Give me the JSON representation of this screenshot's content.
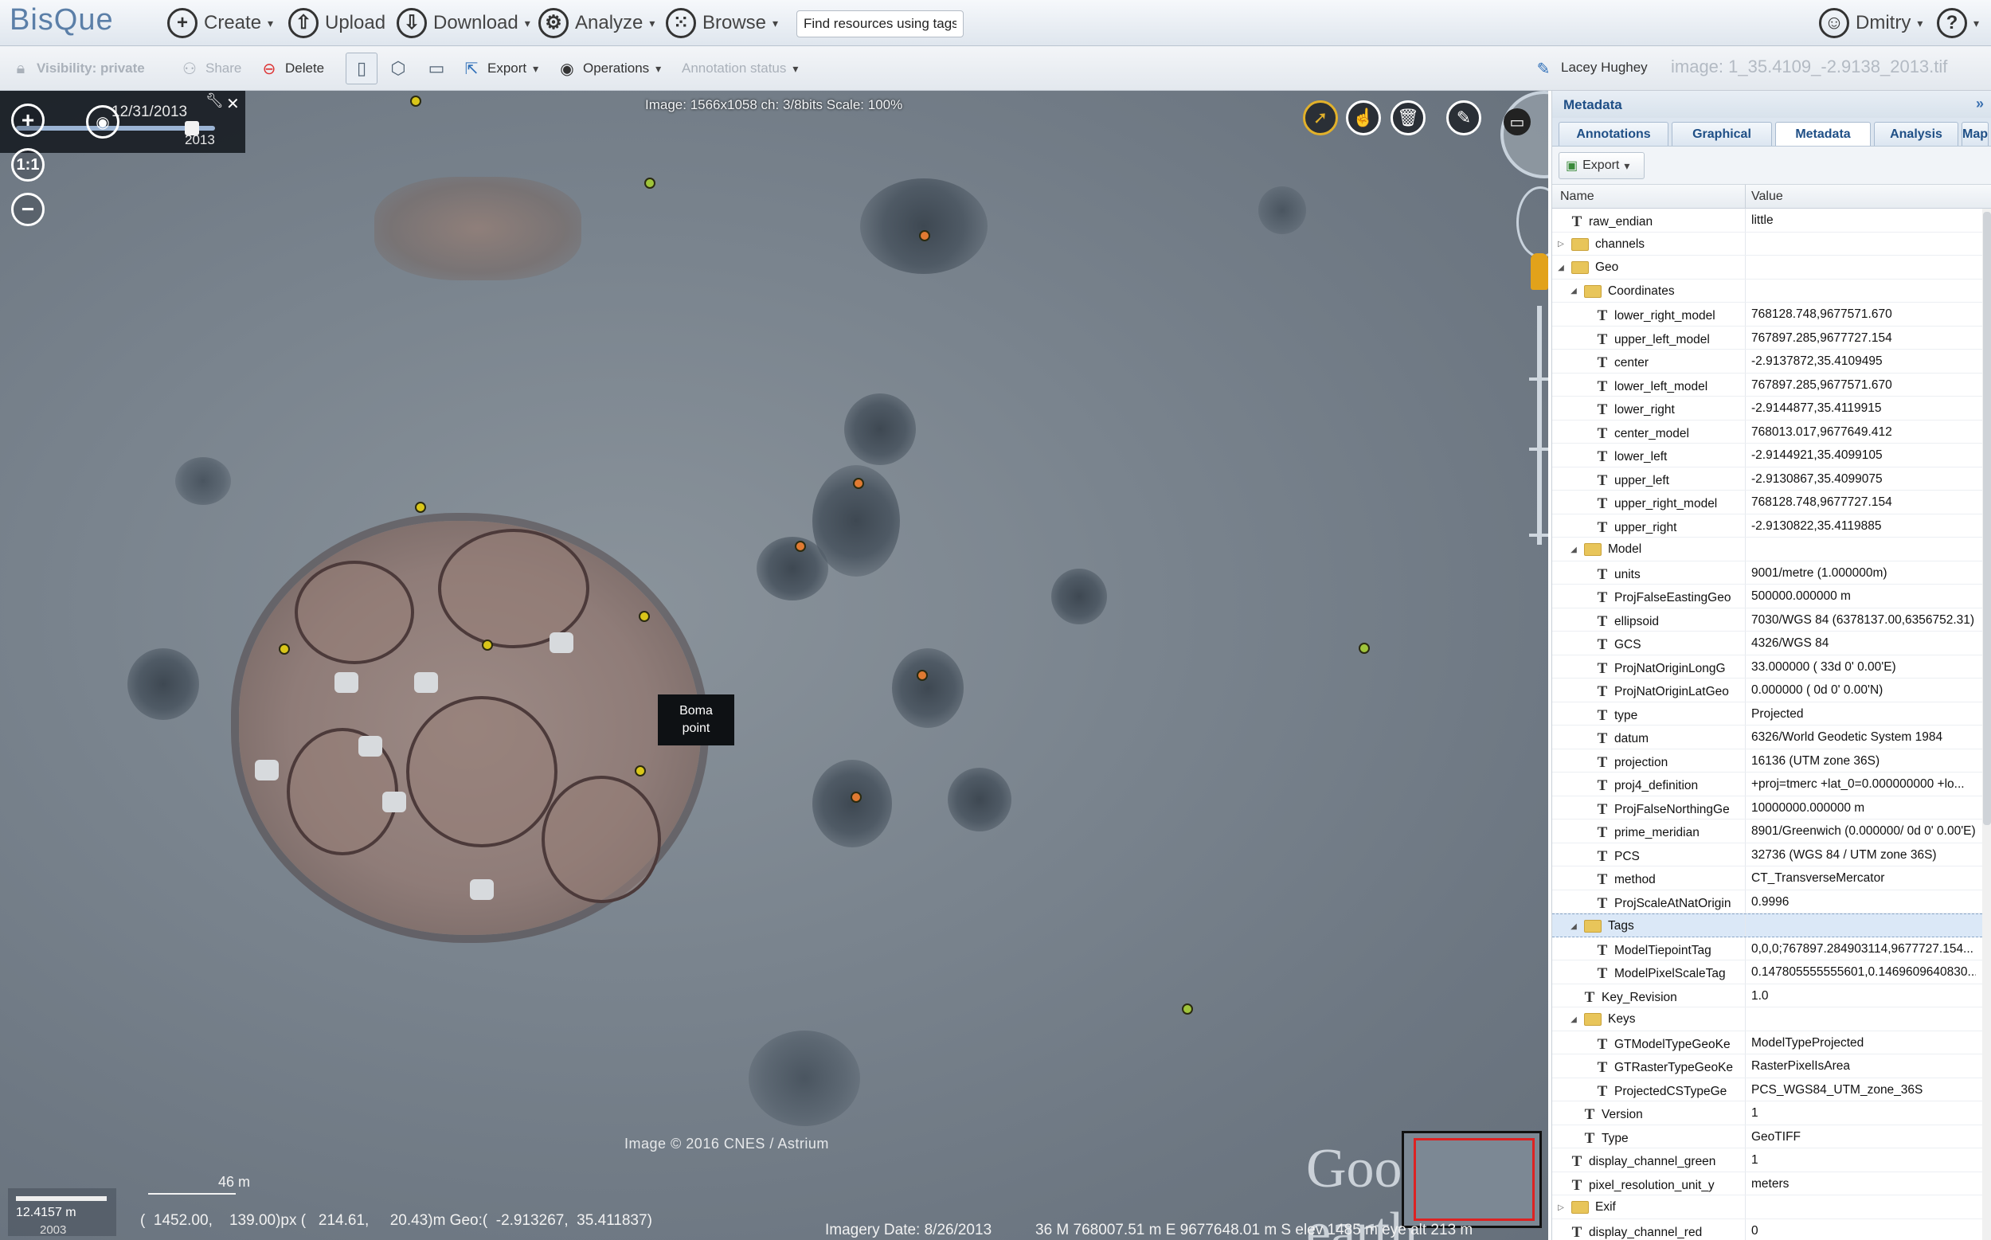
{
  "app": {
    "logo": "BisQue"
  },
  "header": {
    "menus": [
      {
        "label": "Create",
        "icon": "plus-circle-icon"
      },
      {
        "label": "Upload",
        "icon": "upload-icon"
      },
      {
        "label": "Download",
        "icon": "download-icon"
      },
      {
        "label": "Analyze",
        "icon": "analyze-icon"
      },
      {
        "label": "Browse",
        "icon": "grid-icon"
      }
    ],
    "tag_search_placeholder": "Find resources using tags",
    "user": "Dmitry",
    "help": "?"
  },
  "toolbar": {
    "visibility": "Visibility: private",
    "share": "Share",
    "delete": "Delete",
    "export": "Export",
    "operations": "Operations",
    "annotation_status": "Annotation status",
    "owner": "Lacey Hughey",
    "image_name": "image: 1_35.4109_-2.9138_2013.tif"
  },
  "viewer": {
    "image_info": "Image: 1566x1058 ch: 3/8bits Scale: 100%",
    "date": "12/31/2013",
    "year": "2013",
    "zoom_in": "+",
    "zoom_reset": "1:1",
    "zoom_out": "−",
    "annotation_label_line1": "Boma",
    "annotation_label_line2": "point",
    "copyright": "Image © 2016 CNES / Astrium",
    "imagery_date": "Imagery Date: 8/26/2013",
    "coord_readout": "36 M 768007.51 m E 9677648.01 m S  elev  1485 m     eye alt  213 m",
    "px_readout": "(  1452.00,    139.00)px (   214.61,     20.43)m Geo:(  -2.913267,  35.411837)",
    "scale_text": "12.4157 m",
    "scale_year": "2003",
    "scale_46": "46 m",
    "google": "Google earth"
  },
  "panel": {
    "title": "Metadata",
    "tabs": [
      "Annotations",
      "Graphical",
      "Metadata",
      "Analysis",
      "Map"
    ],
    "active_tab": "Metadata",
    "export": "Export",
    "columns": {
      "name": "Name",
      "value": "Value"
    },
    "rows": [
      {
        "level": 0,
        "kind": "T",
        "name": "raw_endian",
        "value": "little"
      },
      {
        "level": 0,
        "kind": "folder",
        "expanded": false,
        "name": "channels",
        "value": ""
      },
      {
        "level": 0,
        "kind": "folder",
        "expanded": true,
        "name": "Geo",
        "value": ""
      },
      {
        "level": 1,
        "kind": "folder",
        "expanded": true,
        "name": "Coordinates",
        "value": ""
      },
      {
        "level": 2,
        "kind": "T",
        "name": "lower_right_model",
        "value": "768128.748,9677571.670"
      },
      {
        "level": 2,
        "kind": "T",
        "name": "upper_left_model",
        "value": "767897.285,9677727.154"
      },
      {
        "level": 2,
        "kind": "T",
        "name": "center",
        "value": "-2.9137872,35.4109495"
      },
      {
        "level": 2,
        "kind": "T",
        "name": "lower_left_model",
        "value": "767897.285,9677571.670"
      },
      {
        "level": 2,
        "kind": "T",
        "name": "lower_right",
        "value": "-2.9144877,35.4119915"
      },
      {
        "level": 2,
        "kind": "T",
        "name": "center_model",
        "value": "768013.017,9677649.412"
      },
      {
        "level": 2,
        "kind": "T",
        "name": "lower_left",
        "value": "-2.9144921,35.4099105"
      },
      {
        "level": 2,
        "kind": "T",
        "name": "upper_left",
        "value": "-2.9130867,35.4099075"
      },
      {
        "level": 2,
        "kind": "T",
        "name": "upper_right_model",
        "value": "768128.748,9677727.154"
      },
      {
        "level": 2,
        "kind": "T",
        "name": "upper_right",
        "value": "-2.9130822,35.4119885"
      },
      {
        "level": 1,
        "kind": "folder",
        "expanded": true,
        "name": "Model",
        "value": ""
      },
      {
        "level": 2,
        "kind": "T",
        "name": "units",
        "value": "9001/metre (1.000000m)"
      },
      {
        "level": 2,
        "kind": "T",
        "name": "ProjFalseEastingGeo",
        "value": "500000.000000 m"
      },
      {
        "level": 2,
        "kind": "T",
        "name": "ellipsoid",
        "value": "7030/WGS 84 (6378137.00,6356752.31)"
      },
      {
        "level": 2,
        "kind": "T",
        "name": "GCS",
        "value": "4326/WGS 84"
      },
      {
        "level": 2,
        "kind": "T",
        "name": "ProjNatOriginLongG",
        "value": "33.000000 ( 33d 0' 0.00'E)"
      },
      {
        "level": 2,
        "kind": "T",
        "name": "ProjNatOriginLatGeo",
        "value": "0.000000 ( 0d 0' 0.00'N)"
      },
      {
        "level": 2,
        "kind": "T",
        "name": "type",
        "value": "Projected"
      },
      {
        "level": 2,
        "kind": "T",
        "name": "datum",
        "value": "6326/World Geodetic System 1984"
      },
      {
        "level": 2,
        "kind": "T",
        "name": "projection",
        "value": "16136 (UTM zone 36S)"
      },
      {
        "level": 2,
        "kind": "T",
        "name": "proj4_definition",
        "value": "+proj=tmerc +lat_0=0.000000000 +lo..."
      },
      {
        "level": 2,
        "kind": "T",
        "name": "ProjFalseNorthingGe",
        "value": "10000000.000000 m"
      },
      {
        "level": 2,
        "kind": "T",
        "name": "prime_meridian",
        "value": "8901/Greenwich (0.000000/  0d 0' 0.00'E)"
      },
      {
        "level": 2,
        "kind": "T",
        "name": "PCS",
        "value": "32736 (WGS 84 / UTM zone 36S)"
      },
      {
        "level": 2,
        "kind": "T",
        "name": "method",
        "value": "CT_TransverseMercator"
      },
      {
        "level": 2,
        "kind": "T",
        "name": "ProjScaleAtNatOrigin",
        "value": "0.9996"
      },
      {
        "level": 1,
        "kind": "folder",
        "expanded": true,
        "name": "Tags",
        "value": "",
        "selected": true
      },
      {
        "level": 2,
        "kind": "T",
        "name": "ModelTiepointTag",
        "value": "0,0,0;767897.284903114,9677727.154..."
      },
      {
        "level": 2,
        "kind": "T",
        "name": "ModelPixelScaleTag",
        "value": "0.147805555555601,0.1469609640830..."
      },
      {
        "level": 1,
        "kind": "T",
        "name": "Key_Revision",
        "value": "1.0"
      },
      {
        "level": 1,
        "kind": "folder",
        "expanded": true,
        "name": "Keys",
        "value": ""
      },
      {
        "level": 2,
        "kind": "T",
        "name": "GTModelTypeGeoKe",
        "value": "ModelTypeProjected"
      },
      {
        "level": 2,
        "kind": "T",
        "name": "GTRasterTypeGeoKe",
        "value": "RasterPixelIsArea"
      },
      {
        "level": 2,
        "kind": "T",
        "name": "ProjectedCSTypeGe",
        "value": "PCS_WGS84_UTM_zone_36S"
      },
      {
        "level": 1,
        "kind": "T",
        "name": "Version",
        "value": "1"
      },
      {
        "level": 1,
        "kind": "T",
        "name": "Type",
        "value": "GeoTIFF"
      },
      {
        "level": 0,
        "kind": "T",
        "name": "display_channel_green",
        "value": "1"
      },
      {
        "level": 0,
        "kind": "T",
        "name": "pixel_resolution_unit_y",
        "value": "meters"
      },
      {
        "level": 0,
        "kind": "folder",
        "expanded": false,
        "name": "Exif",
        "value": ""
      },
      {
        "level": 0,
        "kind": "T",
        "name": "display_channel_red",
        "value": "0"
      }
    ]
  }
}
